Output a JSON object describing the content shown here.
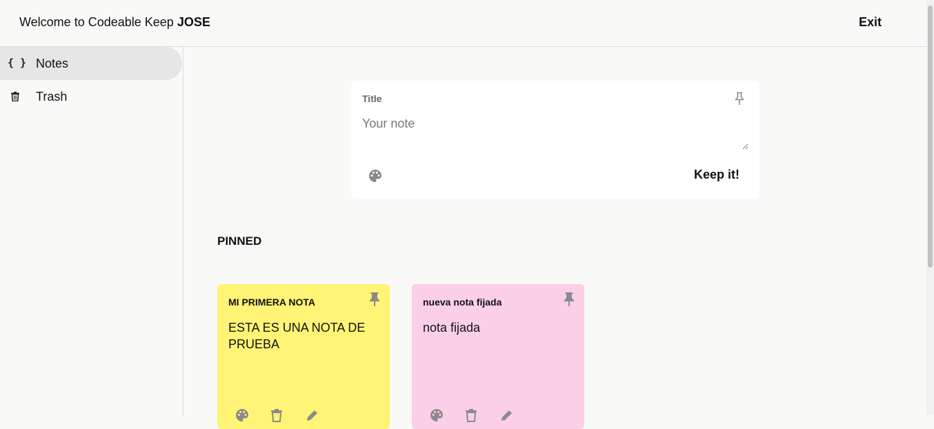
{
  "header": {
    "welcome_prefix": "Welcome to Codeable Keep",
    "username": "JOSE",
    "exit_label": "Exit"
  },
  "sidebar": {
    "items": [
      {
        "label": "Notes",
        "icon": "code-braces-icon",
        "icon_glyph": "{ }",
        "active": true
      },
      {
        "label": "Trash",
        "icon": "trash-icon",
        "active": false
      }
    ]
  },
  "composer": {
    "title_placeholder": "Title",
    "note_placeholder": "Your note",
    "submit_label": "Keep it!",
    "pin_icon": "pin-outline-icon",
    "palette_icon": "palette-icon"
  },
  "pinned": {
    "section_label": "PINNED",
    "notes": [
      {
        "title": "MI PRIMERA NOTA",
        "body": "ESTA ES UNA NOTA DE PRUEBA",
        "color": "#fff475"
      },
      {
        "title": "nueva nota fijada",
        "body": "nota fijada",
        "color": "#fbcfe8"
      }
    ]
  },
  "colors": {
    "background": "#f9f9f8",
    "active_nav": "#e5e6e5",
    "icon_gray": "#8a8a8a"
  }
}
